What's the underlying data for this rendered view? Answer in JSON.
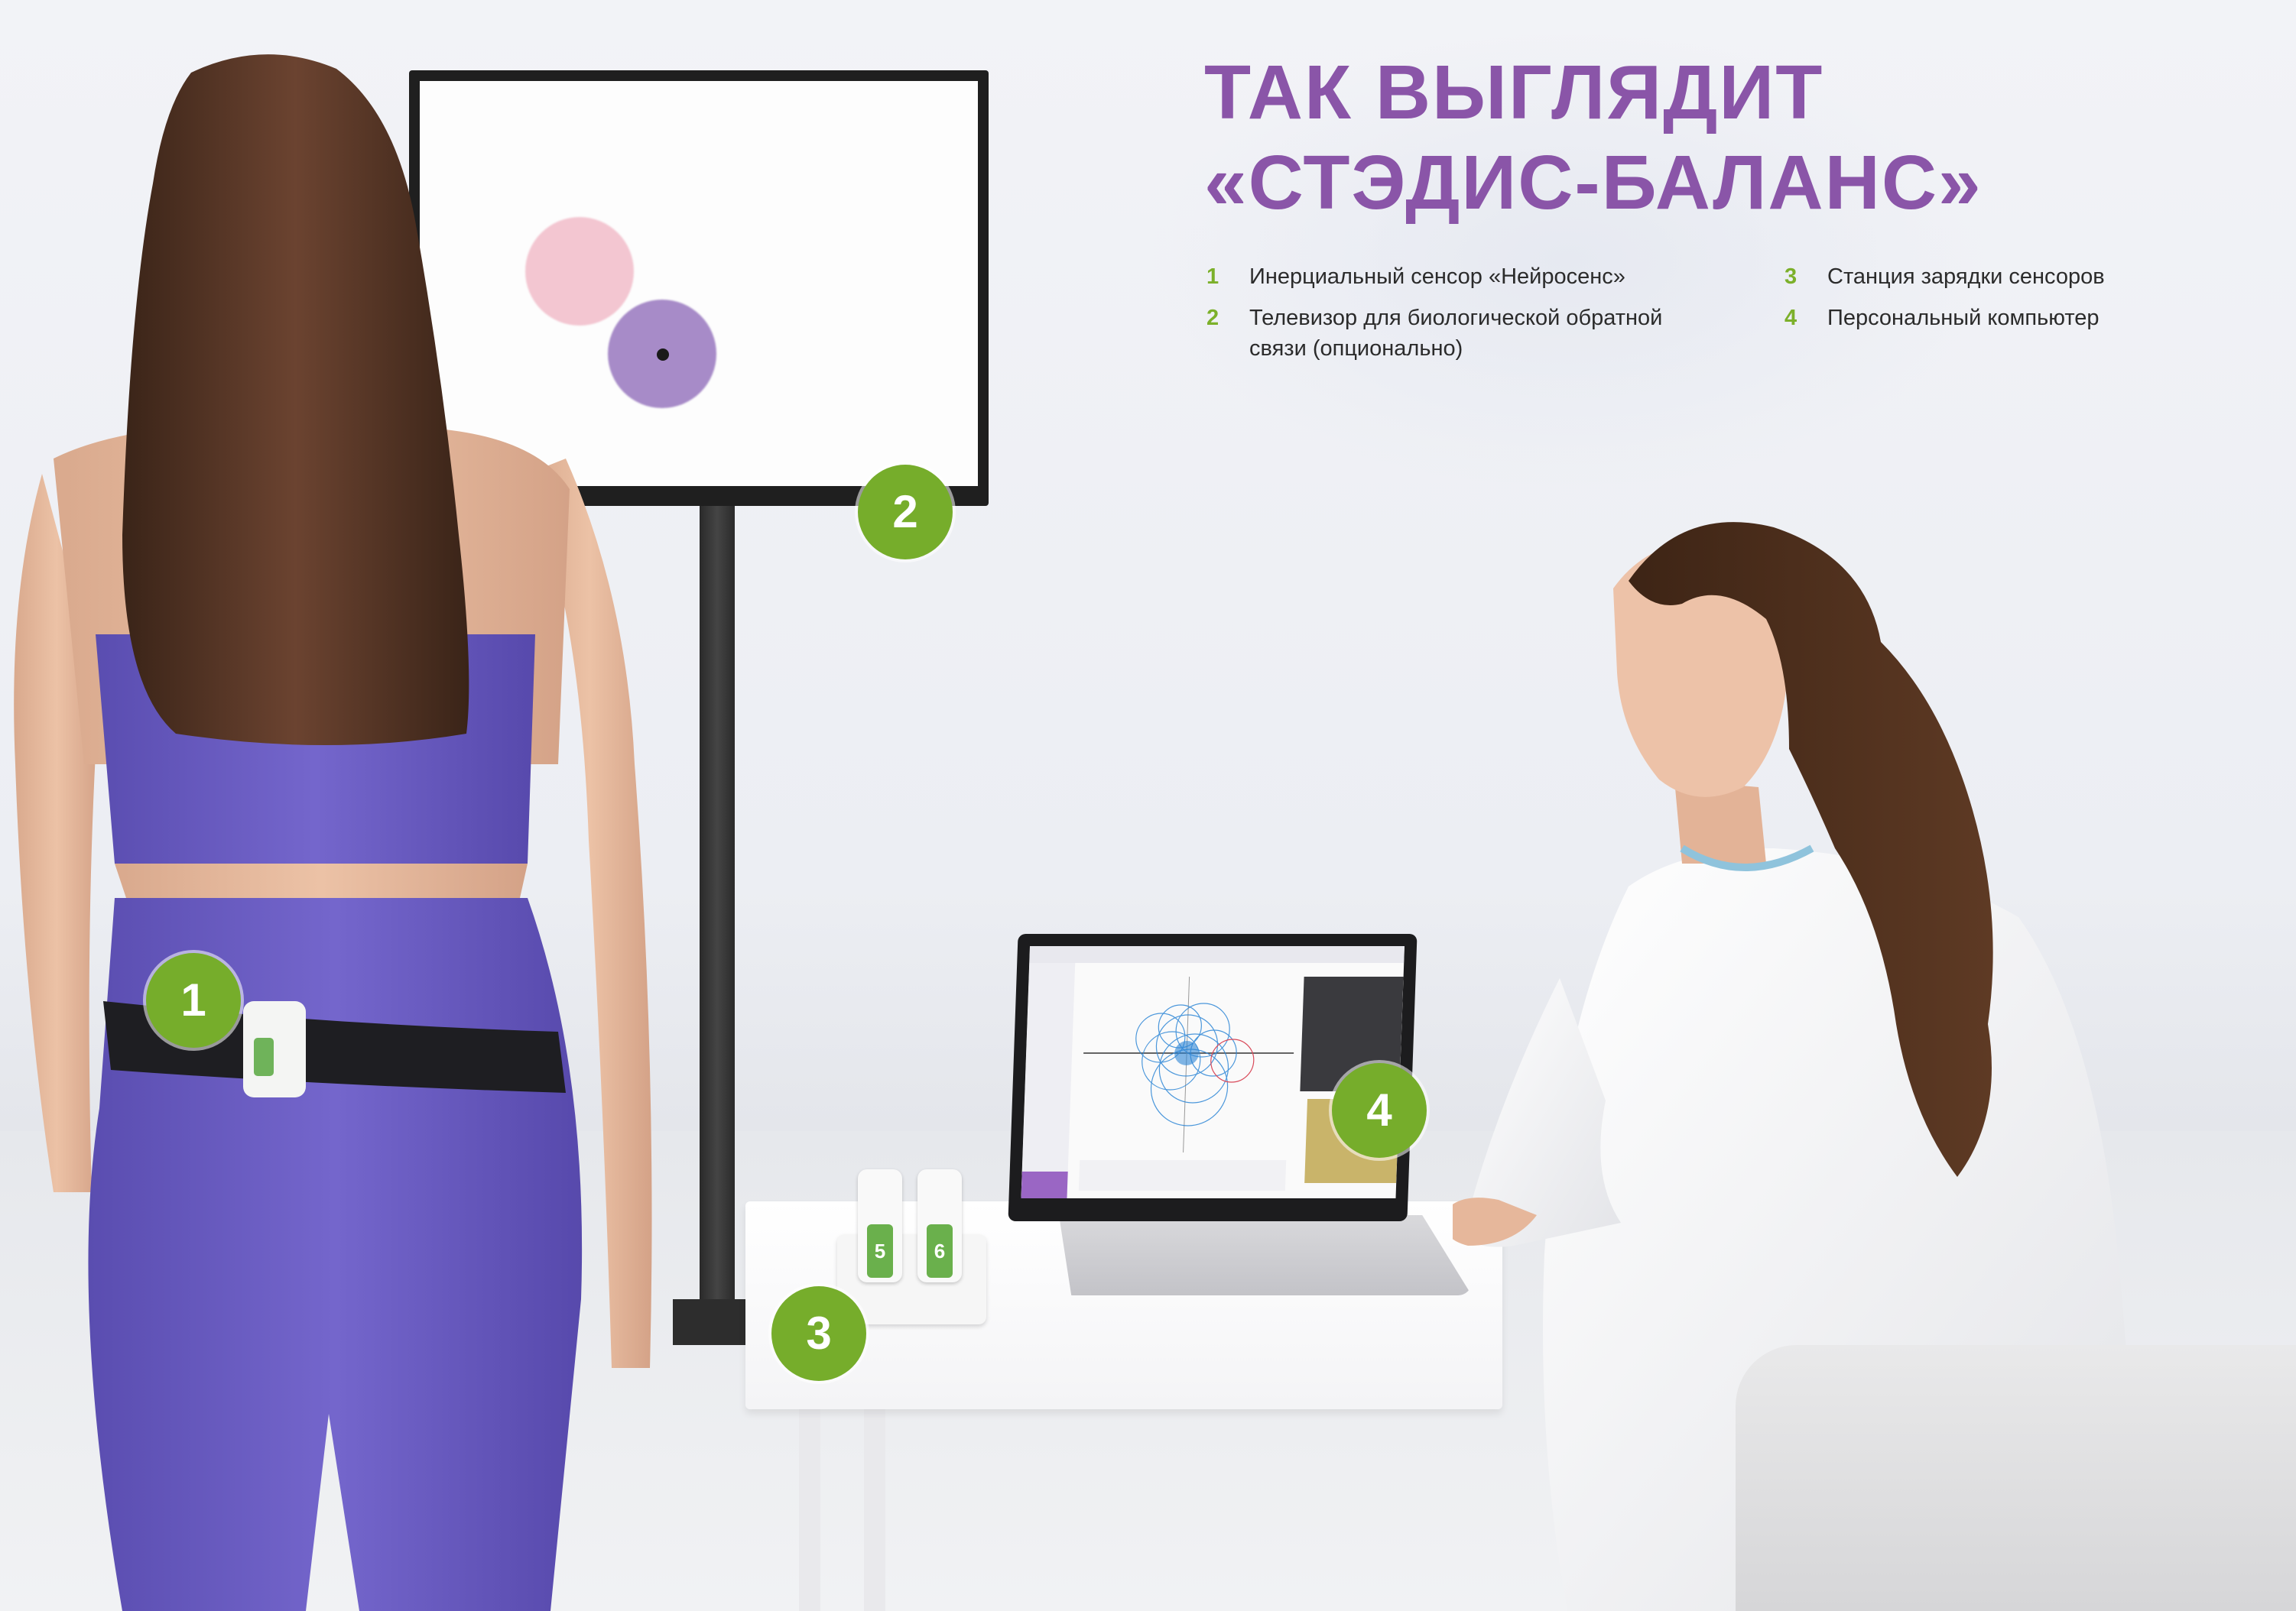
{
  "title": {
    "line1": "ТАК ВЫГЛЯДИТ",
    "line2": "«СТЭДИС-БАЛАНС»"
  },
  "legend": [
    {
      "num": "1",
      "text": "Инерциальный сенсор «Нейросенс»"
    },
    {
      "num": "2",
      "text": "Телевизор для биологической обратной связи (опционально)"
    },
    {
      "num": "3",
      "text": "Станция зарядки сенсоров"
    },
    {
      "num": "4",
      "text": "Персональный компьютер"
    }
  ],
  "badges": {
    "b1": "1",
    "b2": "2",
    "b3": "3",
    "b4": "4"
  },
  "sensor_labels": {
    "s5": "5",
    "s6": "6"
  },
  "colors": {
    "accent_purple": "#8a55a8",
    "badge_green": "#76ad2b",
    "target_pink": "#f3c6d1",
    "target_purple": "#a78bc8"
  }
}
